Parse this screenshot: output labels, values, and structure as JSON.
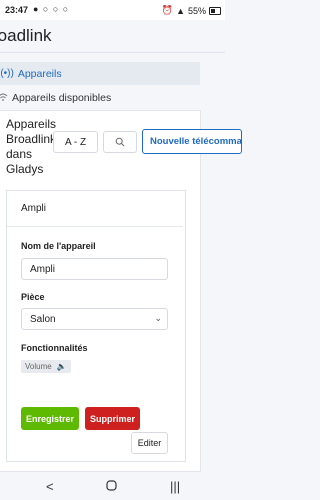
{
  "status": {
    "time": "23:47",
    "icons_left": "● ○ ○ ○",
    "battery": "55%"
  },
  "app": {
    "title": "roadlink"
  },
  "nav": [
    {
      "label": "Appareils",
      "icon": "broadcast-icon"
    },
    {
      "label": "Appareils disponibles",
      "icon": "wifi-icon"
    }
  ],
  "card": {
    "title": "Appareils Broadlink dans Gladys",
    "sort_value": "A - Z",
    "new_button": "Nouvelle télécommande"
  },
  "device": {
    "name_header": "Ampli",
    "name_label": "Nom de l'appareil",
    "name_value": "Ampli",
    "room_label": "Pièce",
    "room_value": "Salon",
    "features_label": "Fonctionnalités",
    "feature_chip": "Volume",
    "save_button": "Enregistrer",
    "delete_button": "Supprimer",
    "edit_button": "Editer"
  },
  "colors": {
    "primary": "#206bc4",
    "success": "#5eba00",
    "danger": "#cd201f"
  }
}
